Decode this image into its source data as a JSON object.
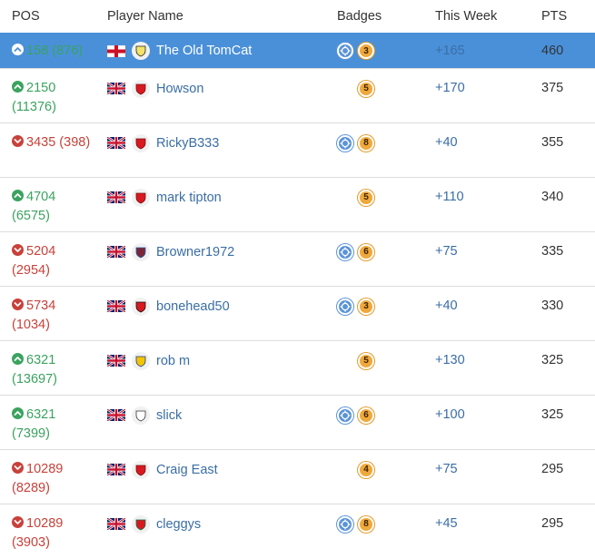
{
  "headers": {
    "pos": "POS",
    "player_name": "Player Name",
    "badges": "Badges",
    "this_week": "This Week",
    "pts": "PTS"
  },
  "colors": {
    "selected_row": "#4a90d9",
    "up": "#3aa35f",
    "down": "#c8413a",
    "link": "#3a6ea5",
    "badge_target": "#5b94d8",
    "badge_number": "#f0a83a"
  },
  "rows": [
    {
      "pos": "158",
      "prev": "(876)",
      "trend": "up",
      "flag": "england-flag-icon",
      "crest": "club-crest-icon",
      "name": "The Old TomCat",
      "target_badge": true,
      "badge_num": "3",
      "this_week": "+165",
      "pts": "460",
      "selected": true
    },
    {
      "pos": "2150",
      "prev": "(11376)",
      "trend": "up",
      "flag": "uk-flag-icon",
      "crest": "club-crest-icon",
      "name": "Howson",
      "target_badge": false,
      "badge_num": "5",
      "this_week": "+170",
      "pts": "375"
    },
    {
      "pos": "3435",
      "prev": "(398)",
      "trend": "down",
      "flag": "uk-flag-icon",
      "crest": "club-crest-icon",
      "name": "RickyB333",
      "target_badge": true,
      "badge_num": "8",
      "this_week": "+40",
      "pts": "355"
    },
    {
      "pos": "4704",
      "prev": "(6575)",
      "trend": "up",
      "flag": "uk-flag-icon",
      "crest": "club-crest-icon",
      "name": "mark tipton",
      "target_badge": false,
      "badge_num": "5",
      "this_week": "+110",
      "pts": "340"
    },
    {
      "pos": "5204",
      "prev": "(2954)",
      "trend": "down",
      "flag": "uk-flag-icon",
      "crest": "club-crest-icon",
      "name": "Browner1972",
      "target_badge": true,
      "badge_num": "6",
      "this_week": "+75",
      "pts": "335"
    },
    {
      "pos": "5734",
      "prev": "(1034)",
      "trend": "down",
      "flag": "uk-flag-icon",
      "crest": "club-crest-icon",
      "name": "bonehead50",
      "target_badge": true,
      "badge_num": "3",
      "this_week": "+40",
      "pts": "330"
    },
    {
      "pos": "6321",
      "prev": "(13697)",
      "trend": "up",
      "flag": "uk-flag-icon",
      "crest": "club-crest-icon",
      "name": "rob m",
      "target_badge": false,
      "badge_num": "5",
      "this_week": "+130",
      "pts": "325"
    },
    {
      "pos": "6321",
      "prev": "(7399)",
      "trend": "up",
      "flag": "uk-flag-icon",
      "crest": "club-crest-icon",
      "name": "slick",
      "target_badge": true,
      "badge_num": "6",
      "this_week": "+100",
      "pts": "325"
    },
    {
      "pos": "10289",
      "prev": "(8289)",
      "trend": "down",
      "flag": "uk-flag-icon",
      "crest": "club-crest-icon",
      "name": "Craig East",
      "target_badge": false,
      "badge_num": "4",
      "this_week": "+75",
      "pts": "295"
    },
    {
      "pos": "10289",
      "prev": "(3903)",
      "trend": "down",
      "flag": "uk-flag-icon",
      "crest": "club-crest-icon",
      "name": "cleggys",
      "target_badge": true,
      "badge_num": "8",
      "this_week": "+45",
      "pts": "295"
    }
  ]
}
